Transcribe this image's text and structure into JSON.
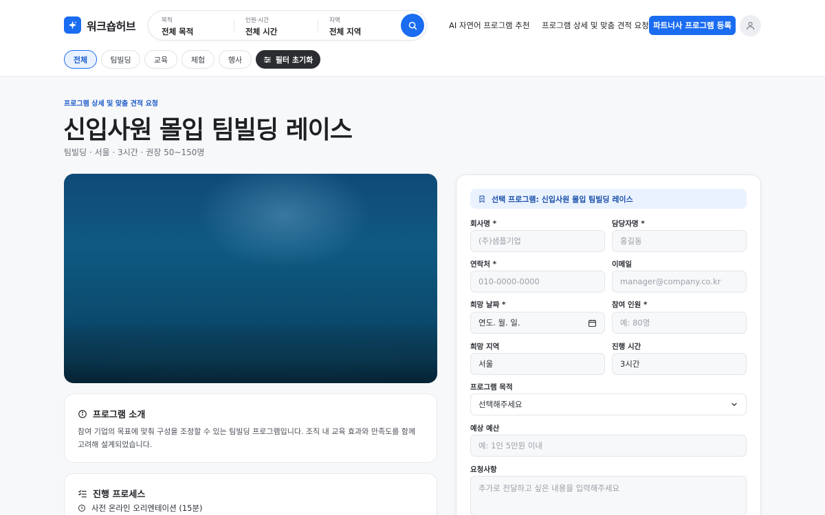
{
  "header": {
    "logo_text": "워크숍허브",
    "search": {
      "purpose_label": "목적",
      "purpose_value": "전체 목적",
      "people_label": "인원·시간",
      "people_value": "전체 시간",
      "region_label": "지역",
      "region_value": "전체 지역"
    },
    "nav": [
      "AI 자연어 프로그램 추천",
      "프로그램 상세 및 맞춤 견적 요청"
    ],
    "partner_button": "파트너사 프로그램 등록"
  },
  "filters": {
    "chips": [
      "전체",
      "팀빌딩",
      "교육",
      "체험",
      "행사"
    ],
    "active": "전체",
    "reset_label": "필터 초기화"
  },
  "page": {
    "eyebrow": "프로그램 상세 및 맞춤 견적 요청",
    "title": "신입사원 몰입 팀빌딩 레이스",
    "meta": "팀빌딩 · 서울 · 3시간 · 권장 50~150명"
  },
  "intro": {
    "title": "프로그램 소개",
    "body": "참여 기업의 목표에 맞춰 구성을 조정할 수 있는 팀빌딩 프로그램입니다. 조직 내 교육 효과와 만족도를 함께 고려해 설계되었습니다."
  },
  "process": {
    "title": "진행 프로세스",
    "steps": [
      "사전 온라인 오리엔테이션 (15분)"
    ]
  },
  "form": {
    "selected": "선택 프로그램: 신입사원 몰입 팀빌딩 레이스",
    "company_label": "회사명 *",
    "company_placeholder": "(주)샘플기업",
    "manager_label": "담당자명 *",
    "manager_placeholder": "홍길동",
    "contact_label": "연락처 *",
    "contact_placeholder": "010-0000-0000",
    "email_label": "이메일",
    "email_placeholder": "manager@company.co.kr",
    "date_label": "희망 날짜 *",
    "date_value": "연도. 월. 일.",
    "people_label": "참여 인원 *",
    "people_placeholder": "예: 80명",
    "region_label": "희망 지역",
    "region_value": "서울",
    "time_label": "진행 시간",
    "time_value": "3시간",
    "purpose_label": "프로그램 목적",
    "purpose_value": "선택해주세요",
    "budget_label": "예상 예산",
    "budget_placeholder": "예: 1인 5만원 이내",
    "request_label": "요청사항",
    "request_placeholder": "추가로 전달하고 싶은 내용을 입력해주세요"
  },
  "colors": {
    "accent": "#1a6cf0",
    "dark_chip": "#2b2d31",
    "info_bg": "#eaf2ff"
  },
  "icons": [
    "sparkle-logo-icon",
    "search-icon",
    "user-icon",
    "filter-icon",
    "info-icon",
    "checklist-icon",
    "clock-icon",
    "bookmark-icon",
    "calendar-icon",
    "chevron-down-icon"
  ]
}
